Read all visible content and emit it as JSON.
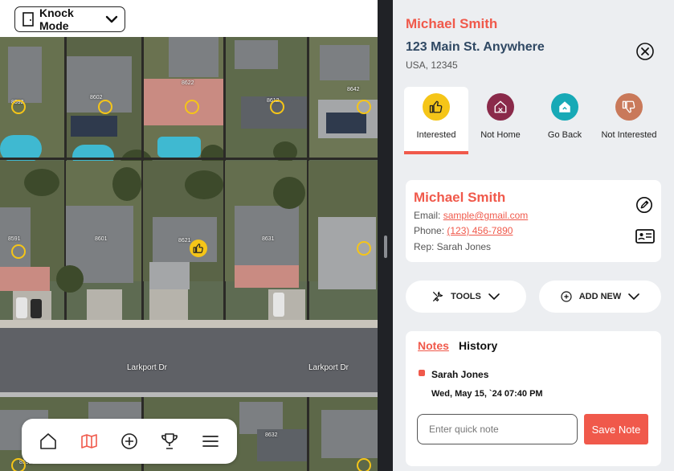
{
  "toolbar": {
    "knock_mode_label": "Knock Mode"
  },
  "map": {
    "street_label_left": "Larkport Dr",
    "street_label_right": "Larkport Dr",
    "house_numbers": [
      "8622",
      "8602",
      "8642",
      "8592",
      "8612",
      "8591",
      "8601",
      "8621",
      "8631",
      "8632",
      "8592"
    ]
  },
  "bottom_nav": [
    "home-icon",
    "map-icon",
    "add-circle-icon",
    "trophy-icon",
    "menu-icon"
  ],
  "lead": {
    "name": "Michael Smith",
    "address_line1": "123 Main St. Anywhere",
    "address_line2": "USA, 12345"
  },
  "statuses": [
    {
      "label": "Interested",
      "color": "#f5c518",
      "icon": "thumbs-up-icon",
      "active": true
    },
    {
      "label": "Not Home",
      "color": "#8a2a4a",
      "icon": "not-home-icon",
      "active": false
    },
    {
      "label": "Go Back",
      "color": "#17a9b6",
      "icon": "go-back-icon",
      "active": false
    },
    {
      "label": "Not Interested",
      "color": "#c9795a",
      "icon": "thumbs-down-icon",
      "active": false
    }
  ],
  "contact": {
    "name": "Michael Smith",
    "email_label": "Email: ",
    "email": "sample@gmail.com",
    "phone_label": "Phone: ",
    "phone": "(123) 456-7890",
    "rep": "Rep: Sarah Jones"
  },
  "actions": {
    "tools_label": "TOOLS",
    "add_new_label": "ADD NEW"
  },
  "notes": {
    "tab_notes": "Notes",
    "tab_history": "History",
    "entries": [
      {
        "author": "Sarah Jones",
        "date": "Wed, May 15, `24 07:40 PM"
      }
    ],
    "input_placeholder": "Enter quick note",
    "save_label": "Save Note"
  },
  "colors": {
    "accent": "#f0594b",
    "navy": "#2f4863"
  }
}
